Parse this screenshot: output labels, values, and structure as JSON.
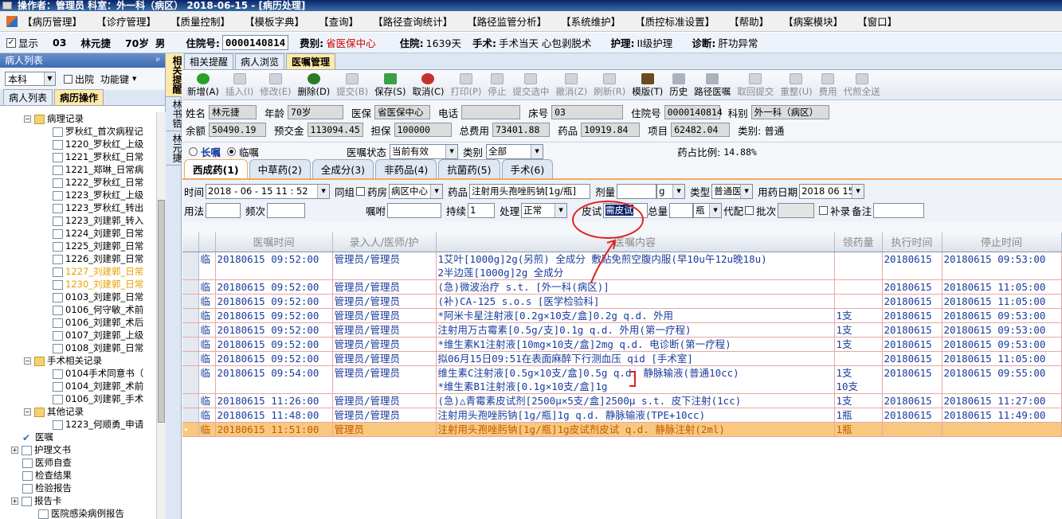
{
  "window": {
    "title": "操作者：管理员  科室：外一科（病区）  2018-06-15 - [病历处理]"
  },
  "menu": [
    "【病历管理】",
    "【诊疗管理】",
    "【质量控制】",
    "【模板字典】",
    "【查询】",
    "【路径查询统计】",
    "【路径监管分析】",
    "【系统维护】",
    "【质控标准设置】",
    "【帮助】",
    "【病案模块】",
    "【窗口】"
  ],
  "patient_bar": {
    "show_label": "显示",
    "bed": "03",
    "name": "林元捷",
    "age": "70岁",
    "sex": "男",
    "inpatient_no_label": "住院号:",
    "inpatient_no": "0000140814",
    "fee_label": "费别:",
    "fee": "省医保中心",
    "stay_label": "住院:",
    "stay": "1639天",
    "surgery_label": "手术:",
    "surgery": "手术当天 心包剥脱术",
    "nursing_label": "护理:",
    "nursing": "II级护理",
    "diag_label": "诊断:",
    "diag": "肝功异常"
  },
  "left_panel": {
    "title": "病人列表",
    "pin": "ᵖ",
    "dept": "本科",
    "discharge_label": "出院",
    "func_label": "功能键",
    "tabs": [
      "病人列表",
      "病历操作"
    ],
    "tree": [
      {
        "label": "病理记录",
        "kind": "folder",
        "indent": 30
      },
      {
        "label": "罗秋红_首次病程记",
        "kind": "doc",
        "indent": 66
      },
      {
        "label": "1220_罗秋红_上级",
        "kind": "doc",
        "indent": 66
      },
      {
        "label": "1221_罗秋红_日常",
        "kind": "doc",
        "indent": 66
      },
      {
        "label": "1221_郑琳_日常病",
        "kind": "doc",
        "indent": 66
      },
      {
        "label": "1222_罗秋红_日常",
        "kind": "doc",
        "indent": 66
      },
      {
        "label": "1223_罗秋红_上级",
        "kind": "doc",
        "indent": 66
      },
      {
        "label": "1223_罗秋红_转出",
        "kind": "doc",
        "indent": 66
      },
      {
        "label": "1223_刘建郭_转入",
        "kind": "doc",
        "indent": 66
      },
      {
        "label": "1224_刘建郭_日常",
        "kind": "doc",
        "indent": 66
      },
      {
        "label": "1225_刘建郭_日常",
        "kind": "doc",
        "indent": 66
      },
      {
        "label": "1226_刘建郭_日常",
        "kind": "doc",
        "indent": 66
      },
      {
        "label": "1227_刘建郭_日常",
        "kind": "doc",
        "indent": 66,
        "orange": true
      },
      {
        "label": "1230_刘建郭_日常",
        "kind": "doc",
        "indent": 66,
        "orange": true
      },
      {
        "label": "0103_刘建郭_日常",
        "kind": "doc",
        "indent": 66
      },
      {
        "label": "0106_何守敏_术前",
        "kind": "doc",
        "indent": 66
      },
      {
        "label": "0106_刘建郭_术后",
        "kind": "doc",
        "indent": 66
      },
      {
        "label": "0107_刘建郭_上级",
        "kind": "doc",
        "indent": 66
      },
      {
        "label": "0108_刘建郭_日常",
        "kind": "doc",
        "indent": 66
      },
      {
        "label": "手术相关记录",
        "kind": "folder",
        "indent": 30
      },
      {
        "label": "0104手术同意书（",
        "kind": "doc",
        "indent": 66
      },
      {
        "label": "0104_刘建郭_术前",
        "kind": "doc",
        "indent": 66
      },
      {
        "label": "0106_刘建郭_手术",
        "kind": "doc",
        "indent": 66
      },
      {
        "label": "其他记录",
        "kind": "folder",
        "indent": 30
      },
      {
        "label": "1223_何顺勇_申请",
        "kind": "doc",
        "indent": 66
      },
      {
        "label": "医嘱",
        "kind": "chk",
        "indent": 28
      },
      {
        "label": "护理文书",
        "kind": "plusdoc",
        "indent": 14
      },
      {
        "label": "医师自查",
        "kind": "doc",
        "indent": 28
      },
      {
        "label": "检查结果",
        "kind": "doc",
        "indent": 28
      },
      {
        "label": "检验报告",
        "kind": "doc",
        "indent": 28
      },
      {
        "label": "报告卡",
        "kind": "plusdoc",
        "indent": 14
      },
      {
        "label": "医院感染病例报告",
        "kind": "doc",
        "indent": 48
      }
    ]
  },
  "side_tabs": [
    "相关提醒",
    "林书锆",
    "林元捷"
  ],
  "main_tabs": [
    "相关提醒",
    "病人浏览",
    "医嘱管理"
  ],
  "toolbar": [
    {
      "label": "新增(A)",
      "icon": "green",
      "disabled": false
    },
    {
      "label": "插入(I)",
      "icon": "grey",
      "disabled": true
    },
    {
      "label": "修改(E)",
      "icon": "grey",
      "disabled": true
    },
    {
      "label": "删除(D)",
      "icon": "dark",
      "disabled": false
    },
    {
      "label": "提交(B)",
      "icon": "grey",
      "disabled": true
    },
    {
      "label": "保存(S)",
      "icon": "save",
      "disabled": false
    },
    {
      "label": "取消(C)",
      "icon": "undo",
      "disabled": false
    },
    {
      "label": "打印(P)",
      "icon": "grey",
      "disabled": true
    },
    {
      "label": "停止",
      "icon": "grey",
      "disabled": true
    },
    {
      "label": "提交选中",
      "icon": "grey",
      "disabled": true
    },
    {
      "label": "撤消(Z)",
      "icon": "grey",
      "disabled": true
    },
    {
      "label": "刷新(R)",
      "icon": "grey",
      "disabled": true
    },
    {
      "label": "模版(T)",
      "icon": "book",
      "disabled": false
    },
    {
      "label": "历史",
      "icon": "grey",
      "disabled": false
    },
    {
      "label": "路径医嘱",
      "icon": "grey",
      "disabled": false
    },
    {
      "label": "取回提交",
      "icon": "grey",
      "disabled": true
    },
    {
      "label": "重整(U)",
      "icon": "grey",
      "disabled": true
    },
    {
      "label": "费用",
      "icon": "grey",
      "disabled": true
    },
    {
      "label": "代煎全送",
      "icon": "grey",
      "disabled": true
    }
  ],
  "info": {
    "row1": [
      [
        "姓名",
        "林元捷",
        60
      ],
      [
        "年龄",
        "70岁",
        70
      ],
      [
        "医保",
        "省医保中心",
        70
      ],
      [
        "电话",
        "",
        74
      ],
      [
        "床号",
        "03",
        90
      ],
      [
        "住院号",
        "0000140814",
        70
      ],
      [
        "科别",
        "外一科（病区）",
        98
      ]
    ],
    "row2": [
      [
        "余额",
        "50490.19",
        72
      ],
      [
        "预交金",
        "113094.45",
        70
      ],
      [
        "担保",
        "100000",
        72
      ],
      [
        "总费用",
        "73401.88",
        72
      ],
      [
        "药品",
        "10919.84",
        74
      ],
      [
        "项目",
        "62482.04",
        74
      ],
      [
        "类别:",
        "普通",
        0
      ]
    ]
  },
  "options": {
    "long": "长嘱",
    "temp": "临嘱",
    "status_label": "医嘱状态",
    "status": "当前有效",
    "category_label": "类别",
    "category": "全部",
    "ratio_label": "药占比例:",
    "ratio": "14.88%"
  },
  "cat_tabs": [
    "西成药(1)",
    "中草药(2)",
    "全成分(3)",
    "非药品(4)",
    "抗菌药(5)",
    "手术(6)"
  ],
  "entry": {
    "time_label": "时间",
    "time": "2018 - 06 - 15   11 : 52",
    "group_label": "同组",
    "pharmacy_label": "药房",
    "pharmacy": "病区中心",
    "drug_label": "药品",
    "drug": "注射用头孢唑肟钠[1g/瓶]",
    "dose_label": "剂量",
    "dose_unit": "g",
    "type_label": "类型",
    "type": "普通医",
    "date_label": "用药日期",
    "date": "2018 06 15",
    "usage_label": "用法",
    "freq_label": "频次",
    "note_label": "嘱咐",
    "dur_label": "持续",
    "dur": "1",
    "handle_label": "处理",
    "handle": "正常",
    "skin_label": "皮试",
    "skin": "需皮试",
    "total_label": "总量",
    "total_unit": "瓶",
    "decoct_label": "代配",
    "batch_label": "批次",
    "supp_label": "补录",
    "remark_label": "备注"
  },
  "grid": {
    "headers": [
      "",
      "医嘱时间",
      "录入人/医师/护",
      "医嘱内容",
      "领药量",
      "执行时间",
      "停止时间"
    ],
    "rows": [
      {
        "flag": "临",
        "time": "20180615 09:52:00",
        "user": "管理员/管理员",
        "content": [
          "1艾叶[1000g]2g(另煎) 全成分 敷贴免煎空腹内服(早10u午12u晚18u)",
          "2半边莲[1000g]2g 全成分"
        ],
        "qty": [
          ""
        ],
        "exec": "20180615",
        "stop": "20180615 09:53:00"
      },
      {
        "flag": "临",
        "time": "20180615 09:52:00",
        "user": "管理员/管理员",
        "content": [
          "(急)微波治疗 s.t. [外一科(病区)]"
        ],
        "qty": [
          ""
        ],
        "exec": "20180615",
        "stop": "20180615 11:05:00"
      },
      {
        "flag": "临",
        "time": "20180615 09:52:00",
        "user": "管理员/管理员",
        "content": [
          "(补)CA-125 s.o.s [医学检验科]"
        ],
        "qty": [
          ""
        ],
        "exec": "20180615",
        "stop": "20180615 11:05:00"
      },
      {
        "flag": "临",
        "time": "20180615 09:52:00",
        "user": "管理员/管理员",
        "content": [
          "*阿米卡星注射液[0.2g×10支/盒]0.2g q.d. 外用"
        ],
        "qty": [
          "1支"
        ],
        "exec": "20180615",
        "stop": "20180615 09:53:00"
      },
      {
        "flag": "临",
        "time": "20180615 09:52:00",
        "user": "管理员/管理员",
        "content": [
          "注射用万古霉素[0.5g/支]0.1g q.d. 外用(第一疗程)"
        ],
        "qty": [
          "1支"
        ],
        "exec": "20180615",
        "stop": "20180615 09:53:00"
      },
      {
        "flag": "临",
        "time": "20180615 09:52:00",
        "user": "管理员/管理员",
        "content": [
          "*维生素K1注射液[10mg×10支/盒]2mg q.d. 电诊断(第一疗程)"
        ],
        "qty": [
          "1支"
        ],
        "exec": "20180615",
        "stop": "20180615 09:53:00"
      },
      {
        "flag": "临",
        "time": "20180615 09:52:00",
        "user": "管理员/管理员",
        "content": [
          "拟06月15日09:51在表面麻醉下行测血压 qid  [手术室]"
        ],
        "qty": [
          ""
        ],
        "exec": "20180615",
        "stop": "20180615 11:05:00"
      },
      {
        "flag": "临",
        "time": "20180615 09:54:00",
        "user": "管理员/管理员",
        "content": [
          "维生素C注射液[0.5g×10支/盒]0.5g q.d. 静脉输液(普通10cc)",
          "*维生素B1注射液[0.1g×10支/盒]1g"
        ],
        "qty": [
          "1支",
          "10支"
        ],
        "exec": "20180615",
        "stop": "20180615 09:55:00"
      },
      {
        "flag": "临",
        "time": "20180615 11:26:00",
        "user": "管理员/管理员",
        "content": [
          "(急)△青霉素皮试剂[2500μ×5支/盒]2500μ s.t. 皮下注射(1cc)"
        ],
        "qty": [
          "1支"
        ],
        "exec": "20180615",
        "stop": "20180615 11:27:00"
      },
      {
        "flag": "临",
        "time": "20180615 11:48:00",
        "user": "管理员/管理员",
        "content": [
          "注射用头孢唑肟钠[1g/瓶]1g q.d. 静脉输液(TPE+10cc)"
        ],
        "qty": [
          "1瓶"
        ],
        "exec": "20180615",
        "stop": "20180615 11:49:00"
      },
      {
        "flag": "临",
        "time": "20180615 11:51:00",
        "user": "管理员",
        "content": [
          "注射用头孢唑肟钠[1g/瓶]1g皮试剂皮试 q.d. 静脉注射(2ml)"
        ],
        "qty": [
          "1瓶"
        ],
        "exec": "",
        "stop": "",
        "selected": true
      }
    ]
  },
  "colors": {
    "accent": "#ffe9a8",
    "grid_text": "#1a3c9c",
    "grid_line": "#e8a6a6",
    "selected_row": "#f8c880",
    "annotation": "#e02020"
  }
}
